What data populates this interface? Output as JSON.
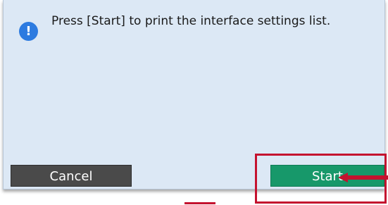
{
  "dialog": {
    "message": "Press [Start] to print the interface settings list.",
    "icon": "info-icon"
  },
  "buttons": {
    "cancel_label": "Cancel",
    "start_label": "Start"
  },
  "annotations": {
    "highlight_color": "#c4122f",
    "arrow_icon": "left-arrow-icon"
  },
  "colors": {
    "dialog_bg": "#dce8f5",
    "info_icon": "#2d7be0",
    "cancel_button": "#4a4a4a",
    "start_button": "#17986a"
  }
}
